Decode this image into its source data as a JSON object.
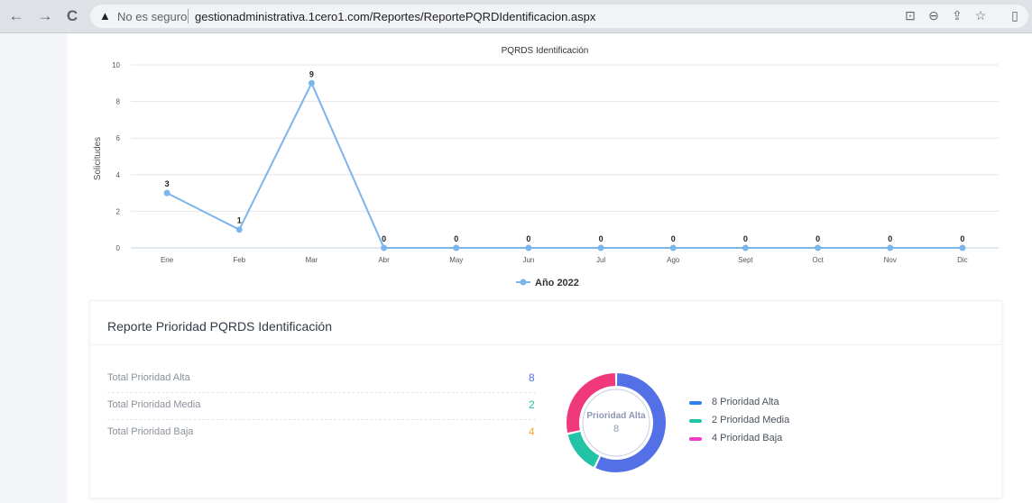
{
  "browser": {
    "insecure_label": "No es seguro",
    "url": "gestionadministrativa.1cero1.com/Reportes/ReportePQRDIdentificacion.aspx"
  },
  "chart_data": {
    "type": "line",
    "title": "PQRDS Identificación",
    "ylabel": "Solicitudes",
    "xlabel": "",
    "categories": [
      "Ene",
      "Feb",
      "Mar",
      "Abr",
      "May",
      "Jun",
      "Jul",
      "Ago",
      "Sept",
      "Oct",
      "Nov",
      "Dic"
    ],
    "series": [
      {
        "name": "Año 2022",
        "values": [
          3,
          1,
          9,
          0,
          0,
          0,
          0,
          0,
          0,
          0,
          0,
          0
        ],
        "color": "#7cb5ec"
      }
    ],
    "ylim": [
      0,
      10
    ],
    "yticks": [
      0,
      2,
      4,
      6,
      8,
      10
    ],
    "grid": true,
    "legend": "bottom-center"
  },
  "report": {
    "title": "Reporte Prioridad PQRDS Identificación",
    "rows": [
      {
        "label": "Total Prioridad Alta",
        "value": "8",
        "color": "#5470e6"
      },
      {
        "label": "Total Prioridad Media",
        "value": "2",
        "color": "#22c3a6"
      },
      {
        "label": "Total Prioridad Baja",
        "value": "4",
        "color": "#f6a93b"
      }
    ],
    "donut": {
      "center_label": "Prioridad Alta",
      "center_value": "8",
      "slices": [
        {
          "label": "Prioridad Alta",
          "value": 8,
          "color": "#5470e6"
        },
        {
          "label": "Prioridad Media",
          "value": 2,
          "color": "#22c3a6"
        },
        {
          "label": "Prioridad Baja",
          "value": 4,
          "color": "#f0397a"
        }
      ]
    },
    "legend": [
      {
        "text": "8 Prioridad Alta",
        "color": "#2f80f0"
      },
      {
        "text": "2 Prioridad Media",
        "color": "#22c3a6"
      },
      {
        "text": "4 Prioridad Baja",
        "color": "#f03cc8"
      }
    ]
  }
}
